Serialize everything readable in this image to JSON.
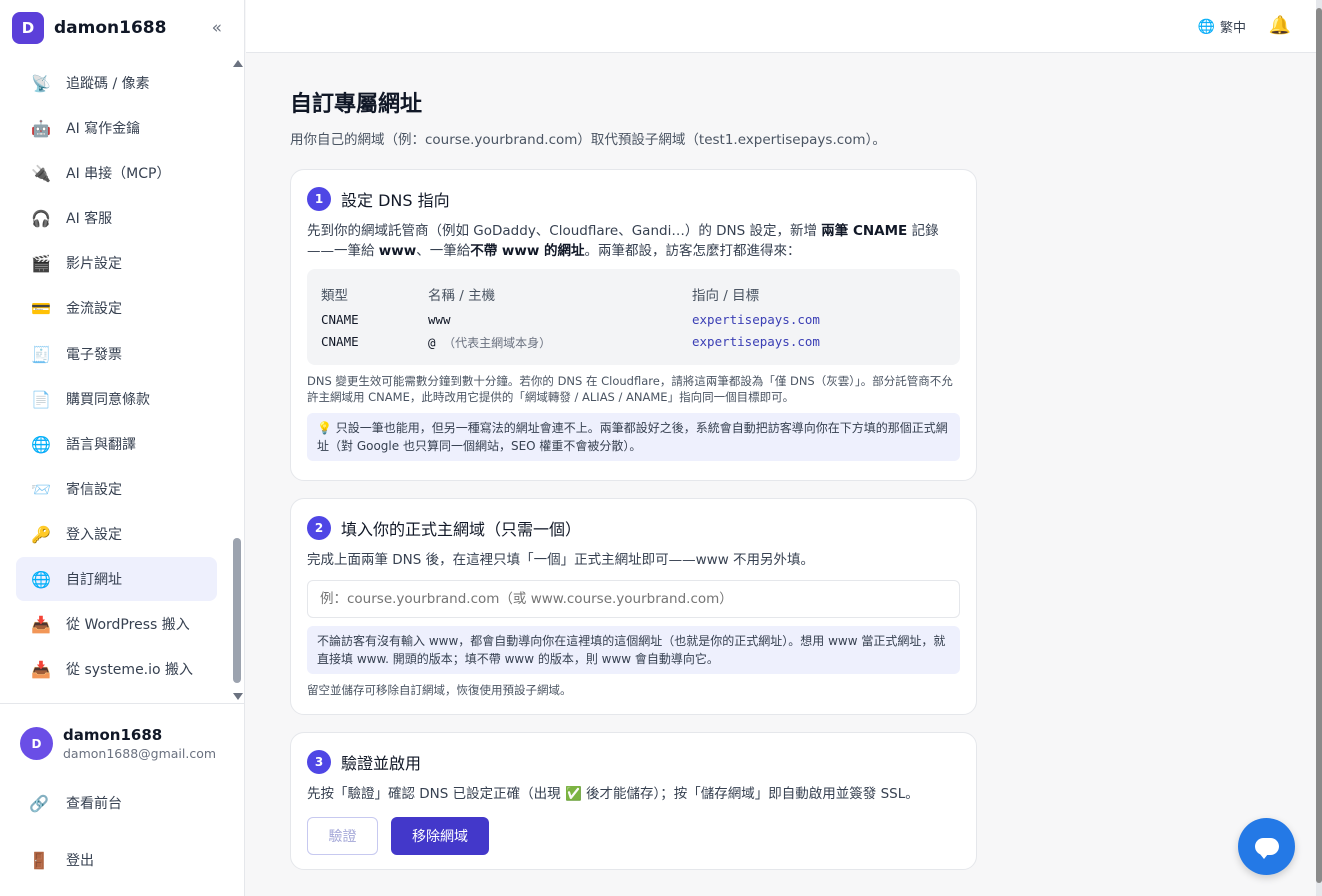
{
  "sidebar": {
    "logo_letter": "D",
    "brand": "damon1688",
    "collapse_icon": "«",
    "items": [
      {
        "label": "追蹤碼 / 像素",
        "icon": "satellite-icon",
        "glyph": "📡"
      },
      {
        "label": "AI 寫作金鑰",
        "icon": "robot-icon",
        "glyph": "🤖"
      },
      {
        "label": "AI 串接（MCP）",
        "icon": "plug-icon",
        "glyph": "🔌"
      },
      {
        "label": "AI 客服",
        "icon": "headphones-icon",
        "glyph": "🎧"
      },
      {
        "label": "影片設定",
        "icon": "clapper-icon",
        "glyph": "🎬"
      },
      {
        "label": "金流設定",
        "icon": "credit-card-icon",
        "glyph": "💳"
      },
      {
        "label": "電子發票",
        "icon": "receipt-icon",
        "glyph": "🧾"
      },
      {
        "label": "購買同意條款",
        "icon": "document-icon",
        "glyph": "📄"
      },
      {
        "label": "語言與翻譯",
        "icon": "globe-icon",
        "glyph": "🌐"
      },
      {
        "label": "寄信設定",
        "icon": "envelope-icon",
        "glyph": "📨"
      },
      {
        "label": "登入設定",
        "icon": "key-icon",
        "glyph": "🔑"
      },
      {
        "label": "自訂網址",
        "icon": "globe-icon",
        "glyph": "🌐"
      },
      {
        "label": "從 WordPress 搬入",
        "icon": "import-icon",
        "glyph": "📥"
      },
      {
        "label": "從 systeme.io 搬入",
        "icon": "import-icon",
        "glyph": "📥"
      }
    ],
    "active_index": 11,
    "user": {
      "initial": "D",
      "name": "damon1688",
      "email": "damon1688@gmail.com"
    },
    "view_frontend": {
      "label": "查看前台",
      "glyph": "🔗"
    },
    "logout": {
      "label": "登出",
      "glyph": "🚪"
    }
  },
  "topbar": {
    "language": "繁中",
    "globe_glyph": "🌐",
    "bell_glyph": "🔔"
  },
  "page": {
    "title": "自訂專屬網址",
    "subtitle": "用你自己的網域（例：course.yourbrand.com）取代預設子網域（test1.expertisepays.com）。"
  },
  "step1": {
    "num": "1",
    "title": "設定 DNS 指向",
    "desc_a": "先到你的網域託管商（例如 GoDaddy、Cloudflare、Gandi…）的 DNS 設定，新增 ",
    "desc_b": "兩筆 CNAME",
    "desc_c": " 記錄——一筆給 ",
    "desc_d": "www",
    "desc_e": "、一筆給",
    "desc_f": "不帶 www 的網址",
    "desc_g": "。兩筆都設，訪客怎麼打都進得來：",
    "table_headers": [
      "類型",
      "名稱 / 主機",
      "指向 / 目標"
    ],
    "rows": [
      {
        "type": "CNAME",
        "name": "www",
        "name_note": "",
        "target": "expertisepays.com"
      },
      {
        "type": "CNAME",
        "name": "@",
        "name_note": "（代表主網域本身）",
        "target": "expertisepays.com"
      }
    ],
    "note": "DNS 變更生效可能需數分鐘到數十分鐘。若你的 DNS 在 Cloudflare，請將這兩筆都設為「僅 DNS（灰雲）」。部分託管商不允許主網域用 CNAME，此時改用它提供的「網域轉發 / ALIAS / ANAME」指向同一個目標即可。",
    "tip": "💡 只設一筆也能用，但另一種寫法的網址會連不上。兩筆都設好之後，系統會自動把訪客導向你在下方填的那個正式網址（對 Google 也只算同一個網站，SEO 權重不會被分散）。"
  },
  "step2": {
    "num": "2",
    "title": "填入你的正式主網域（只需一個）",
    "desc": "完成上面兩筆 DNS 後，在這裡只填「一個」正式主網址即可——www 不用另外填。",
    "placeholder": "例：course.yourbrand.com（或 www.course.yourbrand.com）",
    "tip": "不論訪客有沒有輸入 www，都會自動導向你在這裡填的這個網址（也就是你的正式網址）。想用 www 當正式網址，就直接填 www. 開頭的版本；填不帶 www 的版本，則 www 會自動導向它。",
    "note": "留空並儲存可移除自訂網域，恢復使用預設子網域。"
  },
  "step3": {
    "num": "3",
    "title": "驗證並啟用",
    "desc_a": "先按「驗證」確認 DNS 已設定正確（出現 ",
    "check_glyph": "✅",
    "desc_b": " 後才能儲存）；按「儲存網域」即自動啟用並簽發 SSL。",
    "verify_label": "驗證",
    "remove_label": "移除網域"
  },
  "colors": {
    "accent": "#4f46e5",
    "brand": "#5b3fd9",
    "chat": "#2479e6"
  }
}
